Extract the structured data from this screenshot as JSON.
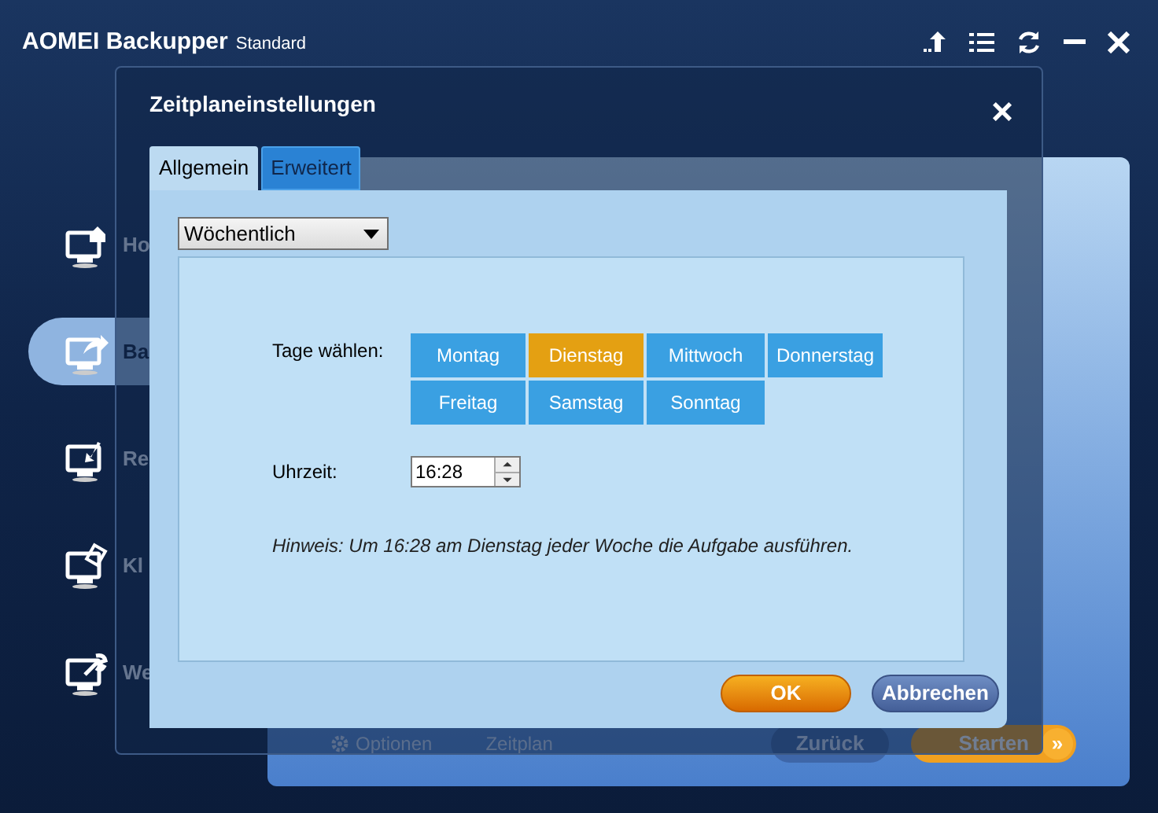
{
  "app": {
    "title": "AOMEI Backupper",
    "edition": "Standard"
  },
  "sidebar": {
    "items": [
      {
        "label": "Ho",
        "selected": false,
        "kind": "home"
      },
      {
        "label": "Ba",
        "selected": true,
        "kind": "backup"
      },
      {
        "label": "Re",
        "selected": false,
        "kind": "restore"
      },
      {
        "label": "Kl",
        "selected": false,
        "kind": "clone"
      },
      {
        "label": "We",
        "selected": false,
        "kind": "tools"
      }
    ]
  },
  "background_panel": {
    "bottom_bar": {
      "options": "Optionen",
      "schedule": "Zeitplan",
      "back": "Zurück",
      "start": "Starten",
      "start_arrow": "»"
    }
  },
  "dialog": {
    "title": "Zeitplaneinstellungen",
    "close": "×",
    "tabs": [
      {
        "label": "Allgemein",
        "selected": true
      },
      {
        "label": "Erweitert",
        "selected": false
      }
    ],
    "frequency": {
      "value": "Wöchentlich"
    },
    "days_label": "Tage wählen:",
    "days": [
      {
        "label": "Montag",
        "selected": false
      },
      {
        "label": "Dienstag",
        "selected": true
      },
      {
        "label": "Mittwoch",
        "selected": false
      },
      {
        "label": "Donnerstag",
        "selected": false
      },
      {
        "label": "Freitag",
        "selected": false
      },
      {
        "label": "Samstag",
        "selected": false
      },
      {
        "label": "Sonntag",
        "selected": false
      }
    ],
    "time_label": "Uhrzeit:",
    "time": {
      "value": "16:28"
    },
    "hint": "Hinweis: Um 16:28 am Dienstag jeder Woche die Aufgabe ausführen.",
    "buttons": [
      {
        "label": "OK",
        "kind": "primary"
      },
      {
        "label": "Abbrechen",
        "kind": "secondary"
      }
    ]
  }
}
